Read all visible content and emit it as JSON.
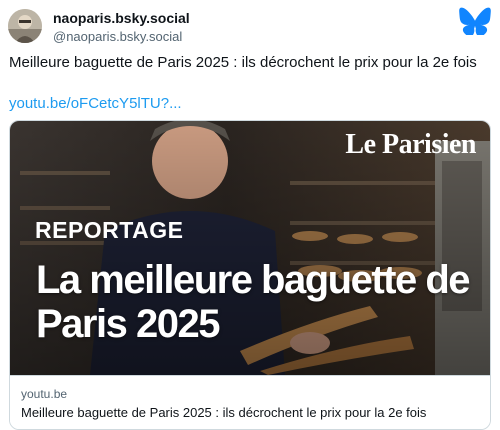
{
  "author": {
    "display_name": "naoparis.bsky.social",
    "handle": "@naoparis.bsky.social"
  },
  "post": {
    "text": "Meilleure baguette de Paris 2025 : ils décrochent le prix pour la 2e fois",
    "link_text": "youtu.be/oFCetcY5lTU?..."
  },
  "card": {
    "thumbnail": {
      "brand": "Le Parisien",
      "tag": "REPORTAGE",
      "headline": "La meilleure baguette de Paris 2025"
    },
    "domain": "youtu.be",
    "title": "Meilleure baguette de Paris 2025 : ils décrochent le prix pour la 2e fois"
  },
  "icons": {
    "platform_logo": "bluesky-butterfly-icon",
    "avatar": "user-avatar"
  },
  "colors": {
    "link": "#1d9bf0",
    "brand_blue": "#1185fe",
    "secondary_text": "#536471"
  }
}
